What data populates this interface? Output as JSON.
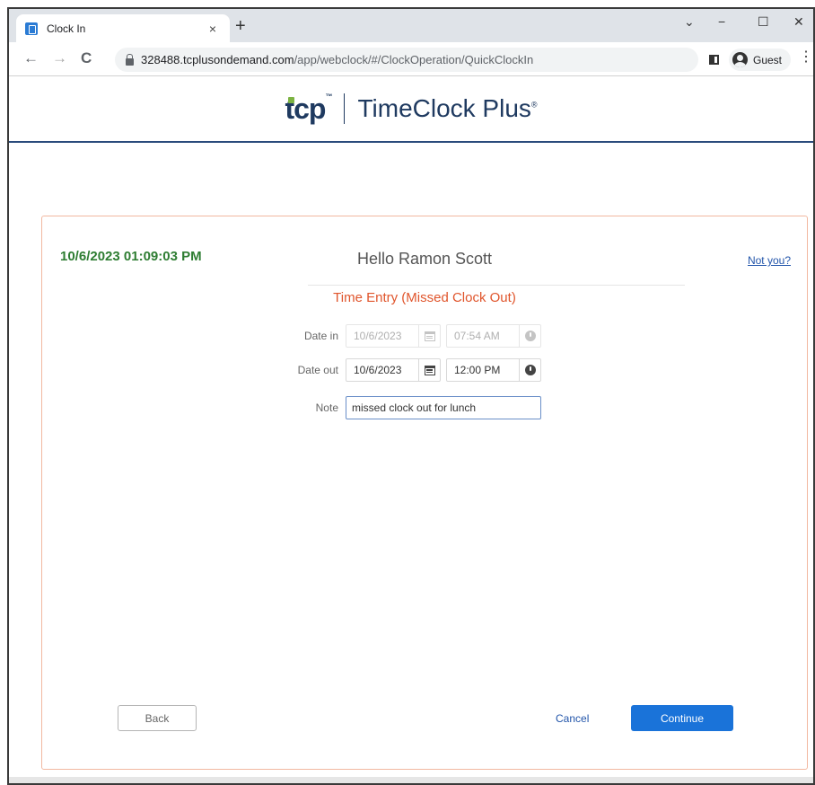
{
  "browser": {
    "tab_title": "Clock In",
    "tab_close": "×",
    "new_tab": "+",
    "url_host": "328488.tcplusondemand.com",
    "url_path": "/app/webclock/#/ClockOperation/QuickClockIn",
    "profile_label": "Guest",
    "minimize": "−",
    "maximize": "☐",
    "close": "✕",
    "dropdown": "⌄",
    "back": "←",
    "forward": "→",
    "reload": "C",
    "menu": "⋮"
  },
  "brand": {
    "logo_short": "tcp",
    "logo_tm": "™",
    "product_name": "TimeClock Plus",
    "product_reg": "®"
  },
  "clock": {
    "datetime": "10/6/2023 01:09:03 PM",
    "greeting": "Hello Ramon Scott",
    "not_you": "Not you?",
    "subtitle": "Time Entry (Missed Clock Out)"
  },
  "form": {
    "date_in_label": "Date in",
    "date_in_value": "10/6/2023",
    "time_in_value": "07:54 AM",
    "date_out_label": "Date out",
    "date_out_value": "10/6/2023",
    "time_out_value": "12:00 PM",
    "note_label": "Note",
    "note_value": "missed clock out for lunch"
  },
  "actions": {
    "back": "Back",
    "cancel": "Cancel",
    "continue": "Continue"
  },
  "colors": {
    "accent": "#1a73d9",
    "datetime": "#2e7d32",
    "subtitle": "#e0552c",
    "brand_navy": "#1f3a60",
    "card_border": "#f2b8a0"
  }
}
